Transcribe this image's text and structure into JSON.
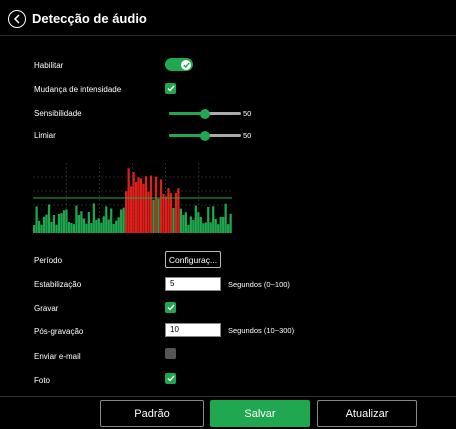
{
  "header": {
    "title": "Detecção de áudio"
  },
  "fields": {
    "habilitar": {
      "label": "Habilitar",
      "value": true
    },
    "mudanca": {
      "label": "Mudança de intensidade",
      "checked": true
    },
    "sensibilidade": {
      "label": "Sensibilidade",
      "value": "50",
      "level": 0.5
    },
    "limiar": {
      "label": "Limiar",
      "value": "50",
      "level": 0.5
    },
    "periodo": {
      "label": "Período",
      "button": "Configuraç..."
    },
    "estabilizacao": {
      "label": "Estabilização",
      "value": "5",
      "unit": "Segundos (0~100)"
    },
    "gravar": {
      "label": "Gravar",
      "checked": true
    },
    "posgravacao": {
      "label": "Pós-gravação",
      "value": "10",
      "unit": "Segundos (10~300)"
    },
    "email": {
      "label": "Enviar e-mail",
      "checked": false
    },
    "foto": {
      "label": "Foto",
      "checked": true
    }
  },
  "footer": {
    "padrao": "Padrão",
    "salvar": "Salvar",
    "atualizar": "Atualizar"
  },
  "colors": {
    "accent": "#1fa84f",
    "alarm": "#e0201a",
    "background": "#000000"
  },
  "icons": {
    "back": "back-arrow-icon",
    "check": "check-icon"
  }
}
